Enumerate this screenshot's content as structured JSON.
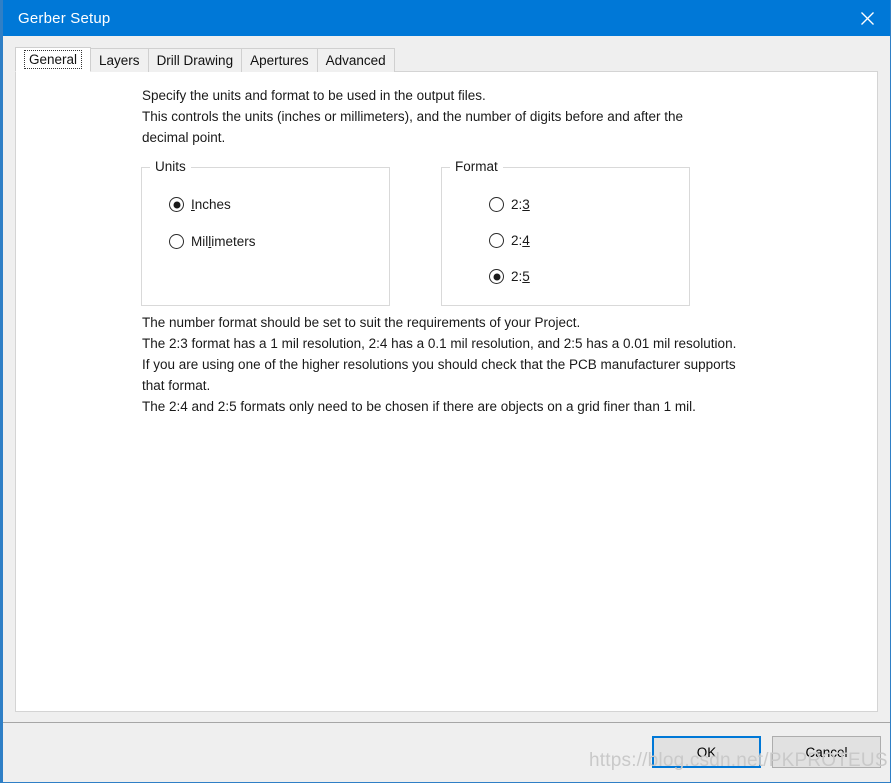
{
  "window": {
    "title": "Gerber Setup",
    "close_icon": "close-icon",
    "accent_color": "#0078d7",
    "border_color": "#2f7fc6",
    "panel_background": "#ffffff",
    "dialog_background": "#efefef"
  },
  "tabs": [
    {
      "label": "General",
      "selected": true
    },
    {
      "label": "Layers",
      "selected": false
    },
    {
      "label": "Drill Drawing",
      "selected": false
    },
    {
      "label": "Apertures",
      "selected": false
    },
    {
      "label": "Advanced",
      "selected": false
    }
  ],
  "general": {
    "description_top": "Specify the units and format to be used in the output files.\nThis controls the units (inches or millimeters), and the number of digits before and after the\ndecimal point.",
    "description_bottom": "The number format should be set to suit the requirements of your Project.\nThe 2:3 format has a 1 mil resolution, 2:4 has a 0.1 mil resolution, and 2:5 has a 0.01 mil resolution.\nIf you are using one of the higher resolutions you should check that the PCB manufacturer supports\nthat format.\nThe 2:4 and 2:5 formats only need to be chosen if there are objects on a grid finer than 1 mil.",
    "units": {
      "legend": "Units",
      "options": [
        {
          "label": "Inches",
          "accel": "I",
          "accel_index": 0,
          "checked": true
        },
        {
          "label": "Millimeters",
          "accel": "l",
          "accel_index": 3,
          "checked": false
        }
      ]
    },
    "format": {
      "legend": "Format",
      "options": [
        {
          "label": "2:3",
          "accel": "3",
          "accel_index": 2,
          "checked": false
        },
        {
          "label": "2:4",
          "accel": "4",
          "accel_index": 2,
          "checked": false
        },
        {
          "label": "2:5",
          "accel": "5",
          "accel_index": 2,
          "checked": true
        }
      ]
    }
  },
  "buttons": {
    "ok": "OK",
    "cancel": "Cancel"
  },
  "watermark": "https://blog.csdn.net/PKPROTEUS"
}
